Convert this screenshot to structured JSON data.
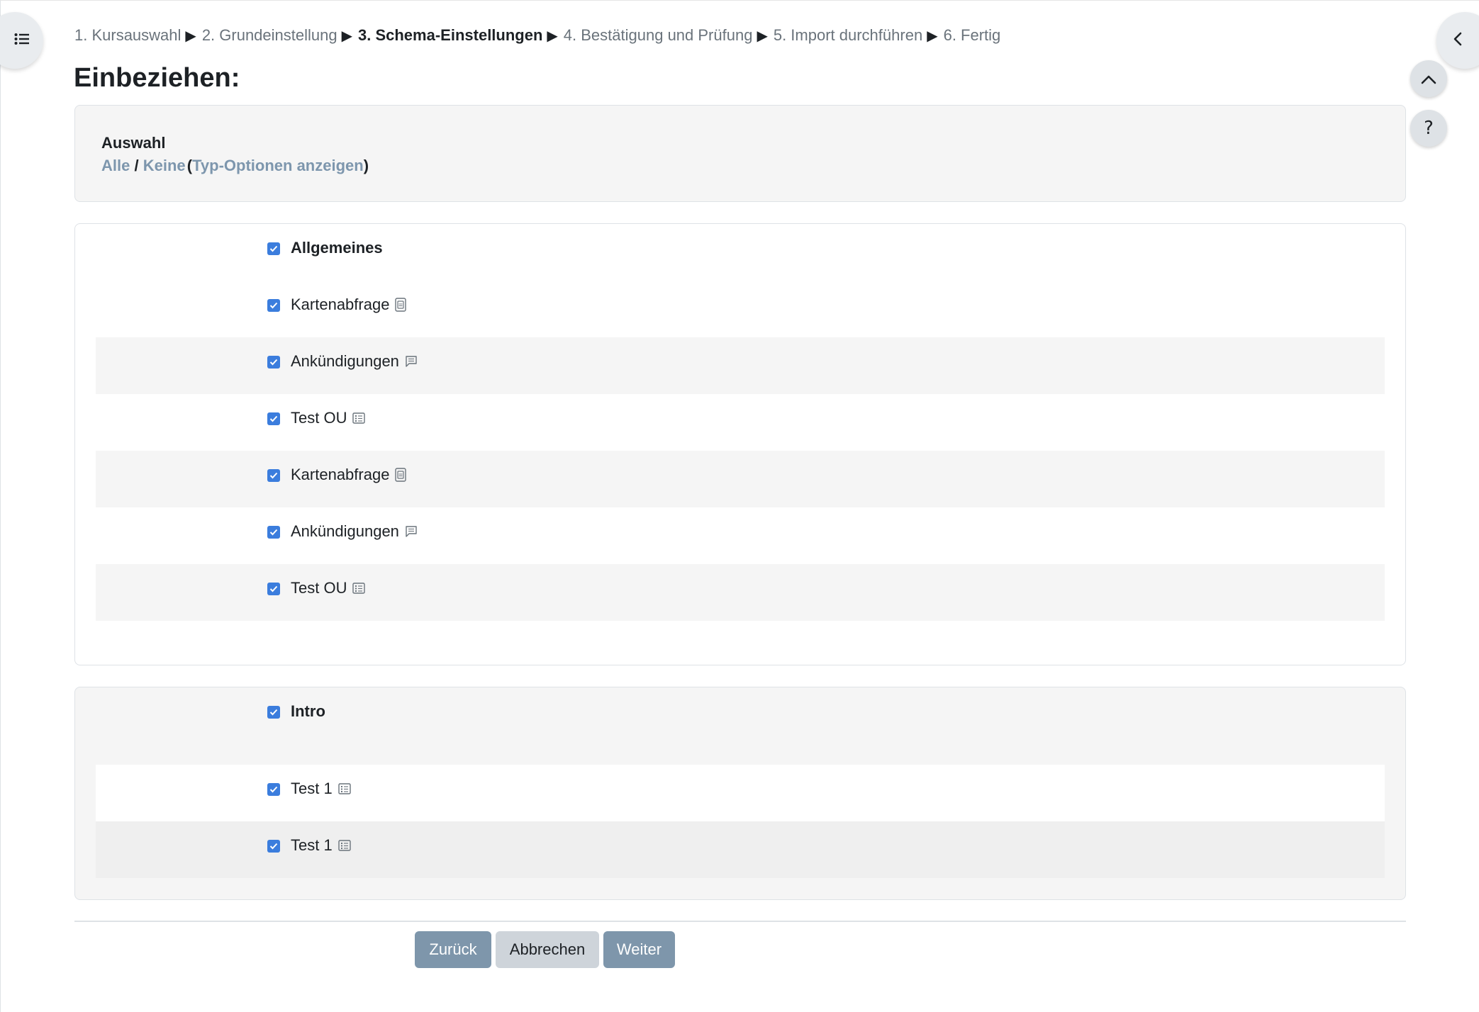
{
  "breadcrumb": {
    "steps": [
      "1. Kursauswahl",
      "2. Grundeinstellung",
      "3. Schema-Einstellungen",
      "4. Bestätigung und Prüfung",
      "5. Import durchführen",
      "6. Fertig"
    ],
    "current_index": 2,
    "separator": "▶"
  },
  "page_title": "Einbeziehen:",
  "selection": {
    "title": "Auswahl",
    "all_link": "Alle",
    "slash": "/",
    "none_link": "Keine",
    "paren_open": "(",
    "type_options_link": "Typ-Optionen anzeigen",
    "paren_close": ")"
  },
  "sections": [
    {
      "header": "Allgemeines",
      "checked": true,
      "activities": [
        {
          "label": "Kartenabfrage",
          "icon": "flashcard-icon",
          "checked": true
        },
        {
          "label": "Ankündigungen",
          "icon": "forum-icon",
          "checked": true
        },
        {
          "label": "Test OU",
          "icon": "quiz-icon",
          "checked": true
        },
        {
          "label": "Kartenabfrage",
          "icon": "flashcard-icon",
          "checked": true
        },
        {
          "label": "Ankündigungen",
          "icon": "forum-icon",
          "checked": true
        },
        {
          "label": "Test OU",
          "icon": "quiz-icon",
          "checked": true
        }
      ]
    },
    {
      "header": "Intro",
      "checked": true,
      "activities": [
        {
          "label": "Test 1",
          "icon": "quiz-icon",
          "checked": true
        },
        {
          "label": "Test 1",
          "icon": "quiz-icon",
          "checked": true
        }
      ]
    }
  ],
  "buttons": {
    "back": "Zurück",
    "cancel": "Abbrechen",
    "next": "Weiter"
  },
  "floating": {
    "help_label": "?"
  },
  "colors": {
    "checkbox": "#3b7ddd",
    "link": "#7d96ad",
    "primary_button": "#7e96ab",
    "secondary_button": "#ced4da",
    "panel_shade": "#f5f5f5"
  }
}
